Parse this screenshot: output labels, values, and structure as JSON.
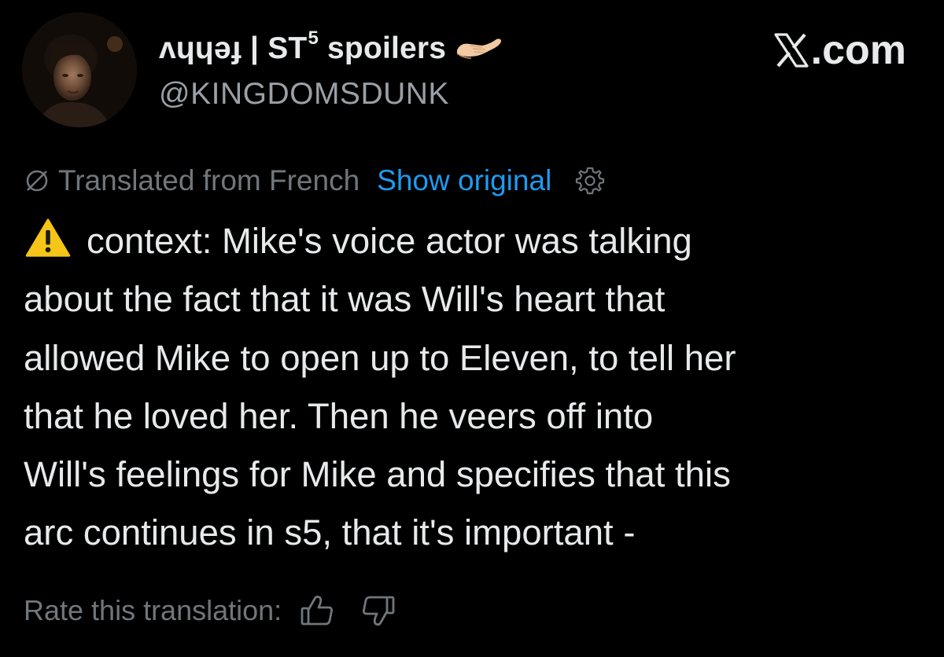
{
  "header": {
    "display_name": "ʌɥɥǝɟ | ST",
    "display_name_superscript": "5",
    "display_name_suffix": " spoilers",
    "handle": "@KINGDOMSDUNK",
    "site_label": ".com",
    "emoji": "palm-up-hand-icon"
  },
  "translation": {
    "translated_label": "Translated from French",
    "show_original_label": "Show original",
    "icons": [
      "translate-icon",
      "gear-icon"
    ]
  },
  "tweet": {
    "warning_icon": "warning-icon",
    "lines": [
      "context: Mike's voice actor was talking",
      "about the fact that it was Will's heart that",
      "allowed Mike to open up to Eleven, to tell her",
      "that he loved her. Then he veers off into",
      "Will's feelings for Mike and specifies that this",
      "arc continues in s5, that it's important -"
    ]
  },
  "rating": {
    "label": "Rate this translation:",
    "icons": [
      "thumbs-up-icon",
      "thumbs-down-icon"
    ]
  },
  "colors": {
    "background": "#000000",
    "text": "#e7e9ea",
    "secondary": "#71767b",
    "link": "#1d9bf0",
    "warning": "#f5c518"
  }
}
